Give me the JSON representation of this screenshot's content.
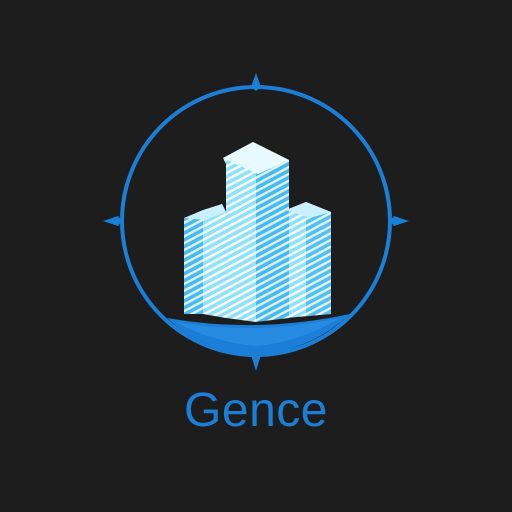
{
  "brand": {
    "name": "Gence"
  },
  "colors": {
    "background": "#1d1d1d",
    "primary_blue": "#1b7fd8",
    "building_light": "#7fd8f4",
    "building_stripe": "#f2fcff",
    "building_mid": "#3aa8e6"
  },
  "icons": {
    "emblem": "compass-city-logo-icon",
    "buildings": "skyscraper-icon"
  }
}
